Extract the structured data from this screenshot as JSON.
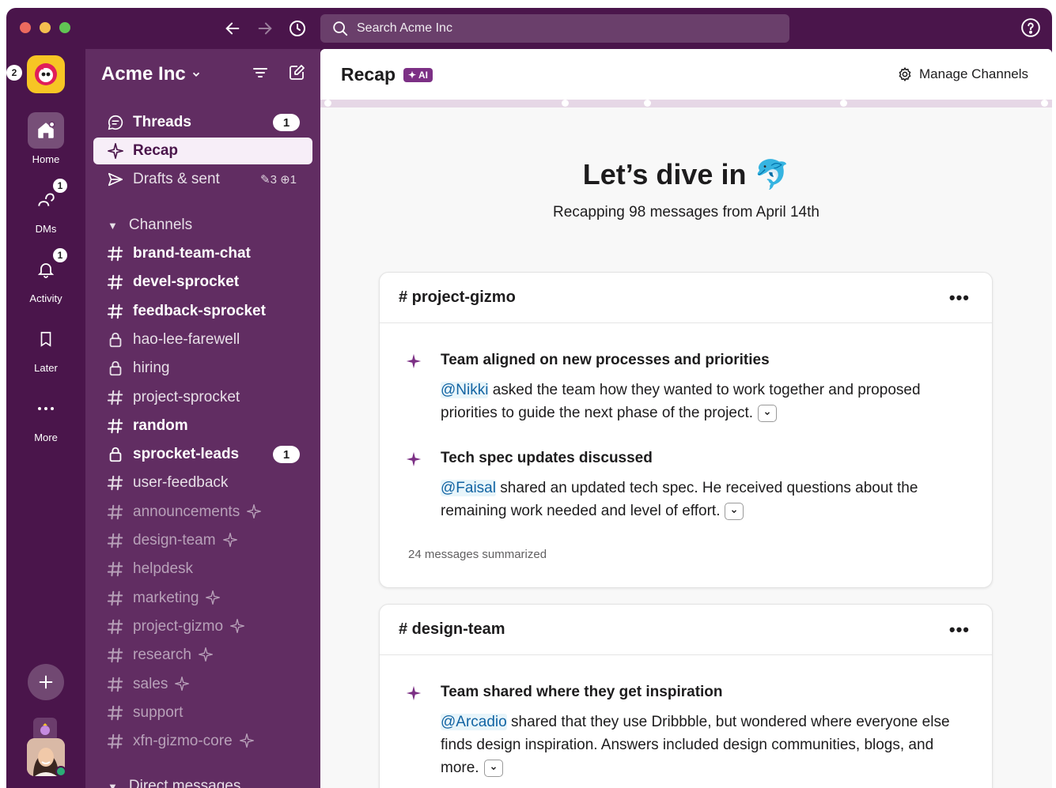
{
  "titlebar": {
    "search_placeholder": "Search Acme Inc"
  },
  "rail": {
    "workspace_badge": "2",
    "items": [
      {
        "label": "Home",
        "badge": ""
      },
      {
        "label": "DMs",
        "badge": "1"
      },
      {
        "label": "Activity",
        "badge": "1"
      },
      {
        "label": "Later",
        "badge": ""
      },
      {
        "label": "More",
        "badge": ""
      }
    ]
  },
  "sidebar": {
    "workspace_name": "Acme Inc",
    "top_items": [
      {
        "label": "Threads",
        "count": "1"
      },
      {
        "label": "Recap"
      },
      {
        "label": "Drafts & sent",
        "meta": "✎3  ⊕1"
      }
    ],
    "channels_header": "Channels",
    "channels": [
      {
        "name": "brand-team-chat",
        "type": "public",
        "style": "bold"
      },
      {
        "name": "devel-sprocket",
        "type": "public",
        "style": "bold"
      },
      {
        "name": "feedback-sprocket",
        "type": "public",
        "style": "bold"
      },
      {
        "name": "hao-lee-farewell",
        "type": "private",
        "style": "normal"
      },
      {
        "name": "hiring",
        "type": "private",
        "style": "normal"
      },
      {
        "name": "project-sprocket",
        "type": "public",
        "style": "normal"
      },
      {
        "name": "random",
        "type": "public",
        "style": "bold"
      },
      {
        "name": "sprocket-leads",
        "type": "private",
        "style": "bold",
        "count": "1"
      },
      {
        "name": "user-feedback",
        "type": "public",
        "style": "normal"
      },
      {
        "name": "announcements",
        "type": "public",
        "style": "muted",
        "sparkle": true
      },
      {
        "name": "design-team",
        "type": "public",
        "style": "muted",
        "sparkle": true
      },
      {
        "name": "helpdesk",
        "type": "public",
        "style": "muted"
      },
      {
        "name": "marketing",
        "type": "public",
        "style": "muted",
        "sparkle": true
      },
      {
        "name": "project-gizmo",
        "type": "public",
        "style": "muted",
        "sparkle": true
      },
      {
        "name": "research",
        "type": "public",
        "style": "muted",
        "sparkle": true
      },
      {
        "name": "sales",
        "type": "public",
        "style": "muted",
        "sparkle": true
      },
      {
        "name": "support",
        "type": "public",
        "style": "muted"
      },
      {
        "name": "xfn-gizmo-core",
        "type": "public",
        "style": "muted",
        "sparkle": true
      }
    ],
    "dm_header": "Direct messages"
  },
  "main": {
    "title": "Recap",
    "ai_badge": "✦ AI",
    "manage_label": "Manage Channels",
    "hero_title": "Let’s dive in 🐬",
    "hero_sub": "Recapping 98 messages from April 14th",
    "cards": [
      {
        "channel": "# project-gizmo",
        "items": [
          {
            "title": "Team aligned on new processes and priorities",
            "mention": "@Nikki",
            "text": " asked the team how they wanted to work together and proposed priorities to guide the next phase of the project."
          },
          {
            "title": "Tech spec updates discussed",
            "mention": "@Faisal",
            "text": " shared an updated tech spec. He received questions about the remaining work needed and level of effort."
          }
        ],
        "footer": "24 messages summarized"
      },
      {
        "channel": "# design-team",
        "items": [
          {
            "title": "Team shared where they get inspiration",
            "mention": "@Arcadio",
            "text": " shared that they use Dribbble, but wondered where everyone else finds design inspiration. Answers included design communities, blogs, and more."
          }
        ]
      }
    ]
  },
  "colors": {
    "aubergine": "#4a154b",
    "sidebar": "#612d62",
    "accent": "#7c3085",
    "mention": "#1264a3"
  }
}
